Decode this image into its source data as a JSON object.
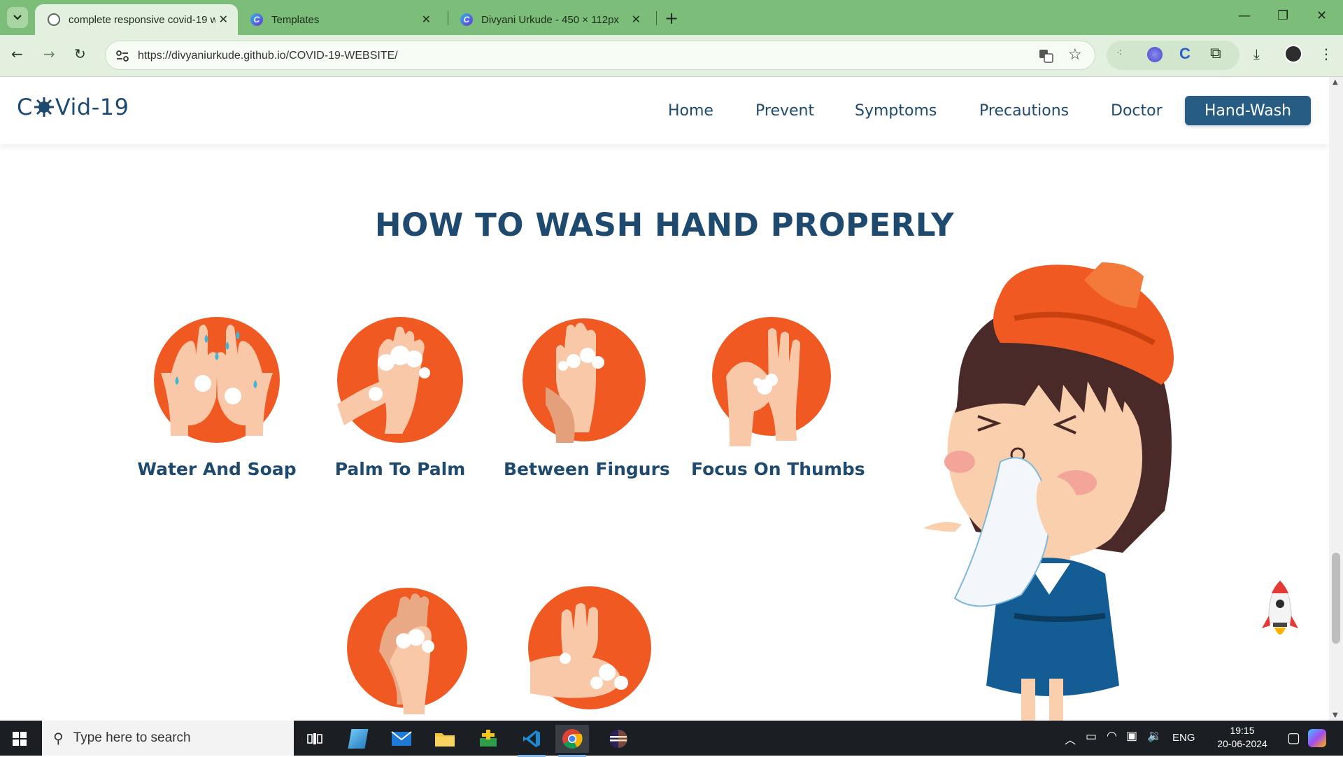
{
  "browser": {
    "tabs": [
      {
        "title": "complete responsive covid-19 w",
        "active": true
      },
      {
        "title": "Templates",
        "active": false
      },
      {
        "title": "Divyani Urkude - 450 × 112px",
        "active": false
      }
    ],
    "url": "https://divyaniurkude.github.io/COVID-19-WEBSITE/"
  },
  "site": {
    "logo_prefix": "C",
    "logo_suffix": "Vid-19",
    "nav": [
      "Home",
      "Prevent",
      "Symptoms",
      "Precautions",
      "Doctor"
    ],
    "nav_active": "Hand-Wash",
    "section_title": "HOW TO WASH HAND PROPERLY",
    "steps": [
      {
        "label": "Water And Soap"
      },
      {
        "label": "Palm To Palm"
      },
      {
        "label": "Between Fingurs"
      },
      {
        "label": "Focus On Thumbs"
      },
      {
        "label": ""
      },
      {
        "label": ""
      }
    ]
  },
  "colors": {
    "accent_orange": "#f05a22",
    "brand_blue": "#1f4a70",
    "button_blue": "#275c85",
    "skin": "#f8c8a8"
  },
  "taskbar": {
    "search_placeholder": "Type here to search",
    "language": "ENG",
    "time": "19:15",
    "date": "20-06-2024"
  }
}
